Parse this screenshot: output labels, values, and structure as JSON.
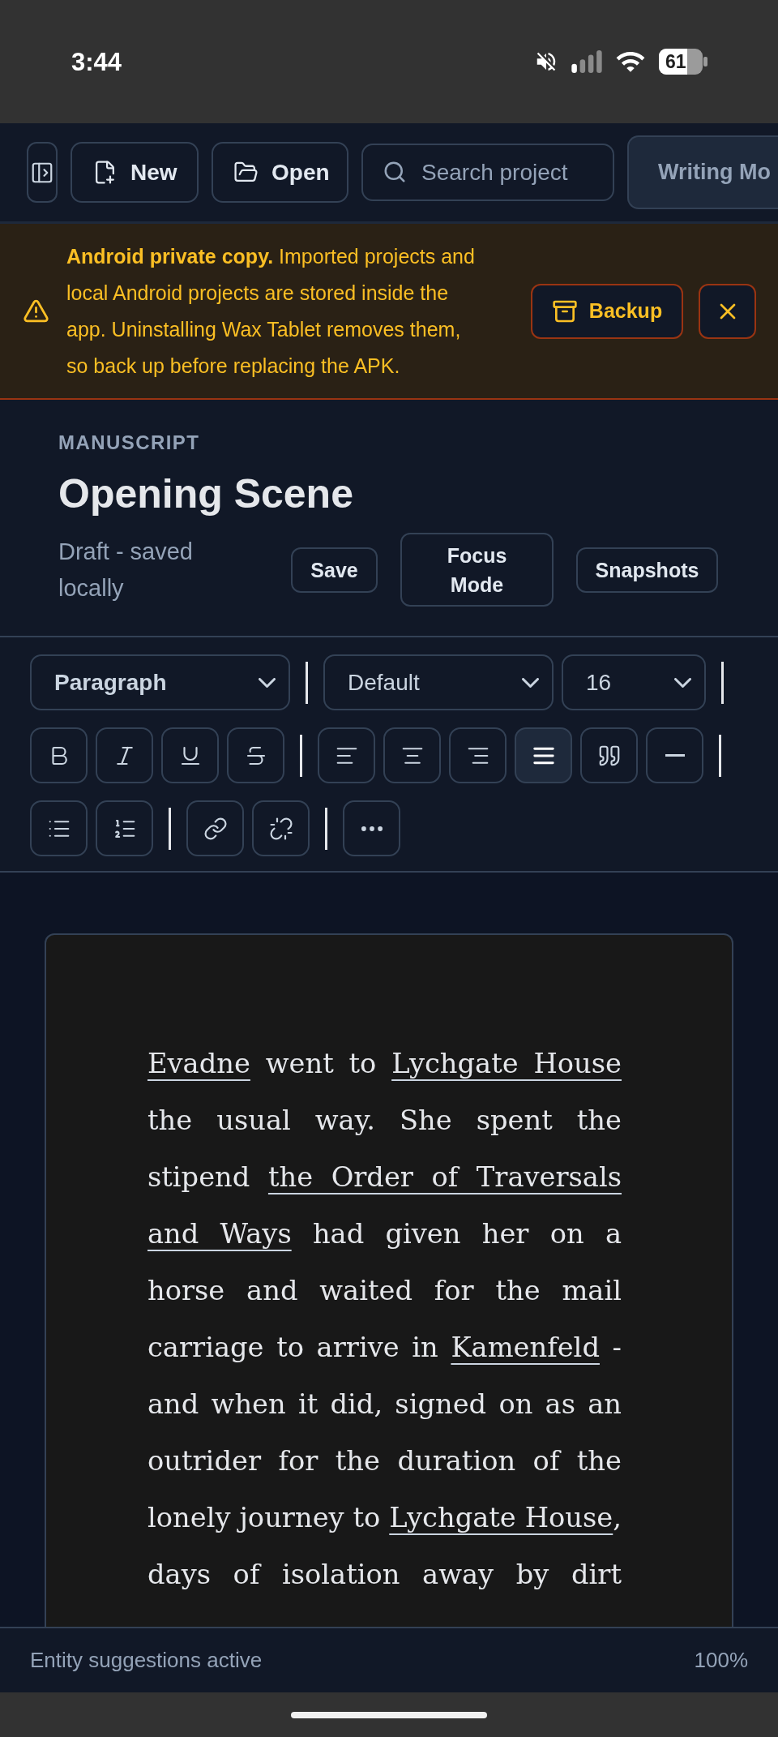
{
  "status_bar": {
    "time": "3:44",
    "battery": "61"
  },
  "toolbar": {
    "buttons": [
      {
        "kind": "new",
        "label": "New"
      },
      {
        "kind": "open",
        "label": "Open"
      }
    ],
    "search": {
      "placeholder": "Search project"
    },
    "mode_button": {
      "label": "Writing Mo"
    }
  },
  "banner": {
    "message": "**Android private copy.** Imported projects and local Android projects are stored inside the app. Uninstalling Wax Tablet removes them, so back up before replacing the APK.",
    "action": "Backup"
  },
  "header": {
    "section": "MANUSCRIPT",
    "title": "Opening Scene",
    "status": "Draft - saved locally",
    "actions": [
      {
        "kind": "save",
        "label": "Save"
      },
      {
        "kind": "focus",
        "label": "Focus Mode"
      },
      {
        "kind": "snapshots",
        "label": "Snapshots"
      }
    ]
  },
  "format_toolbar": {
    "groups": [
      {
        "items": [
          {
            "kind": "block_select",
            "value": "Paragraph"
          }
        ]
      },
      {
        "items": [
          {
            "kind": "font_select",
            "value": "Default"
          },
          {
            "kind": "size_select",
            "value": "16"
          }
        ]
      },
      {
        "items": [
          {
            "kind": "bold",
            "active": false
          },
          {
            "kind": "italic",
            "active": false
          },
          {
            "kind": "underline",
            "active": false
          },
          {
            "kind": "strikethrough",
            "active": false
          }
        ]
      },
      {
        "items": [
          {
            "kind": "align_left",
            "active": false
          },
          {
            "kind": "align_center",
            "active": false
          },
          {
            "kind": "align_right",
            "active": false
          },
          {
            "kind": "align_justify",
            "active": true
          },
          {
            "kind": "blockquote",
            "active": false
          },
          {
            "kind": "horizontal_rule",
            "active": false
          }
        ]
      },
      {
        "items": [
          {
            "kind": "bullet_list",
            "active": false
          },
          {
            "kind": "ordered_list",
            "active": false
          }
        ]
      },
      {
        "items": [
          {
            "kind": "link",
            "active": false
          },
          {
            "kind": "unlink",
            "active": false
          }
        ]
      },
      {
        "items": [
          {
            "kind": "more"
          }
        ]
      }
    ]
  },
  "editor": {
    "paragraph": [
      {
        "text": "Evadne",
        "entity": true
      },
      {
        "text": " went to ",
        "entity": false
      },
      {
        "text": "Lychgate House",
        "entity": true
      },
      {
        "text": " the usual way. She spent the stipend ",
        "entity": false
      },
      {
        "text": "the Order of Traversals and Ways",
        "entity": true
      },
      {
        "text": " had given her on a horse and waited for the mail carriage to arrive in ",
        "entity": false
      },
      {
        "text": "Kamenfeld",
        "entity": true
      },
      {
        "text": " - and when it did, signed on as an outrider for the duration of the lonely journey to ",
        "entity": false
      },
      {
        "text": "Lychgate House",
        "entity": true
      },
      {
        "text": ", days of isolation away by dirt",
        "entity": false
      }
    ]
  },
  "footer": {
    "status": "Entity suggestions active",
    "zoom": "100%"
  }
}
